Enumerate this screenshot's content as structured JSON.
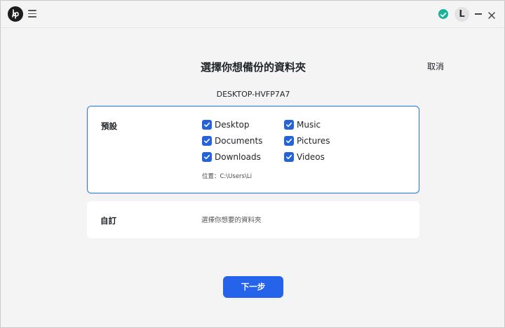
{
  "app": {
    "logo_icon": "app-logo-icon",
    "menu_icon": "hamburger-menu-icon",
    "status_icon": "check-circle-icon",
    "avatar_initial": "L",
    "accent": "#2563eb",
    "status_color": "#19b39a"
  },
  "page": {
    "title": "選擇你想備份的資料夾",
    "cancel_label": "取消",
    "device_name": "DESKTOP-HVFP7A7"
  },
  "default_card": {
    "label": "預設",
    "folders": [
      {
        "label": "Desktop",
        "checked": true
      },
      {
        "label": "Documents",
        "checked": true
      },
      {
        "label": "Downloads",
        "checked": true
      },
      {
        "label": "Music",
        "checked": true
      },
      {
        "label": "Pictures",
        "checked": true
      },
      {
        "label": "Videos",
        "checked": true
      }
    ],
    "location": "位置：C:\\Users\\Li"
  },
  "custom_card": {
    "label": "自訂",
    "hint": "選擇你想要的資料夾"
  },
  "footer": {
    "next_label": "下一步"
  }
}
